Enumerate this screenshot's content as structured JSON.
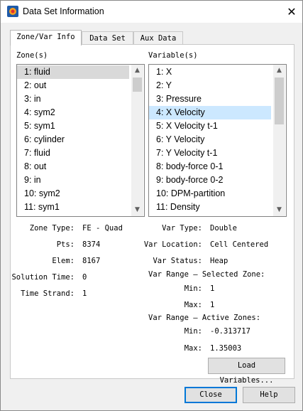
{
  "window": {
    "title": "Data Set Information"
  },
  "tabs": [
    {
      "label": "Zone/Var Info",
      "active": true
    },
    {
      "label": "Data Set",
      "active": false
    },
    {
      "label": "Aux Data",
      "active": false
    }
  ],
  "zones": {
    "header": "Zone(s)",
    "selected_index": 0,
    "items": [
      "1: fluid",
      "2: out",
      "3: in",
      "4: sym2",
      "5: sym1",
      "6: cylinder",
      "7: fluid",
      "8: out",
      "9: in",
      "10: sym2",
      "11: sym1"
    ]
  },
  "variables": {
    "header": "Variable(s)",
    "selected_index": 3,
    "items": [
      "1: X",
      "2: Y",
      "3: Pressure",
      "4: X Velocity",
      "5: X Velocity t-1",
      "6: Y Velocity",
      "7: Y Velocity t-1",
      "8: body-force 0-1",
      "9: body-force 0-2",
      "10: DPM-partition",
      "11: Density"
    ]
  },
  "zone_info": {
    "type_label": "Zone Type:",
    "type_value": "FE - Quad",
    "pts_label": "Pts:",
    "pts_value": "8374",
    "elem_label": "Elem:",
    "elem_value": "8167",
    "soltime_label": "Solution Time:",
    "soltime_value": "0",
    "strand_label": "Time Strand:",
    "strand_value": "1"
  },
  "var_info": {
    "type_label": "Var Type:",
    "type_value": "Double",
    "location_label": "Var Location:",
    "location_value": "Cell Centered",
    "status_label": "Var Status:",
    "status_value": "Heap",
    "sel_zone_header": "Var Range — Selected Zone:",
    "sel_min_label": "Min:",
    "sel_min_value": "1",
    "sel_max_label": "Max:",
    "sel_max_value": "1",
    "active_header": "Var Range — Active Zones:",
    "act_min_label": "Min:",
    "act_min_value": "-0.313717",
    "act_max_label": "Max:",
    "act_max_value": "1.35003"
  },
  "buttons": {
    "load_variables": "Load Variables...",
    "close": "Close",
    "help": "Help"
  },
  "colors": {
    "selection": "#cce8ff",
    "zone_selection": "#d9d9d9",
    "accent": "#0078d7"
  }
}
